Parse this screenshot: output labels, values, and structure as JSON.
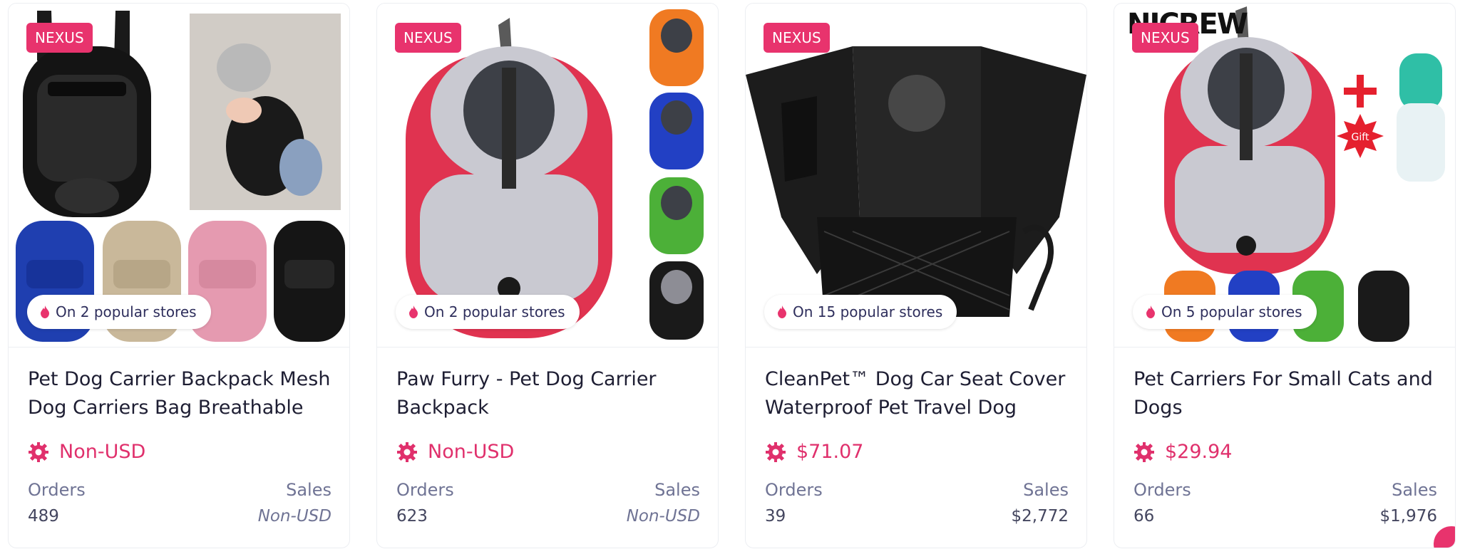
{
  "colors": {
    "accent": "#e8336d",
    "price": "#e0306c",
    "text_dark": "#1e1e33",
    "text_muted": "#6f7394"
  },
  "cards": [
    {
      "badge": "NEXUS",
      "stores": "On 2 popular stores",
      "title": "Pet Dog Carrier Backpack Mesh Dog Carriers Bag Breathable",
      "price": "Non-USD",
      "orders_label": "Orders",
      "sales_label": "Sales",
      "orders": "489",
      "sales": "Non-USD"
    },
    {
      "badge": "NEXUS",
      "stores": "On 2 popular stores",
      "title": "Paw Furry - Pet Dog Carrier Backpack",
      "price": "Non-USD",
      "orders_label": "Orders",
      "sales_label": "Sales",
      "orders": "623",
      "sales": "Non-USD"
    },
    {
      "badge": "NEXUS",
      "stores": "On 15 popular stores",
      "title": "CleanPet™ Dog Car Seat Cover Waterproof Pet Travel Dog",
      "price": "$71.07",
      "orders_label": "Orders",
      "sales_label": "Sales",
      "orders": "39",
      "sales": "$2,772"
    },
    {
      "brand": "NICREW",
      "badge": "NEXUS",
      "stores": "On 5 popular stores",
      "title": "Pet Carriers For Small Cats and Dogs",
      "price": "$29.94",
      "gift": "Gift",
      "orders_label": "Orders",
      "sales_label": "Sales",
      "orders": "66",
      "sales": "$1,976"
    }
  ],
  "icons": {
    "store": "flame-icon",
    "price": "gear-icon"
  }
}
